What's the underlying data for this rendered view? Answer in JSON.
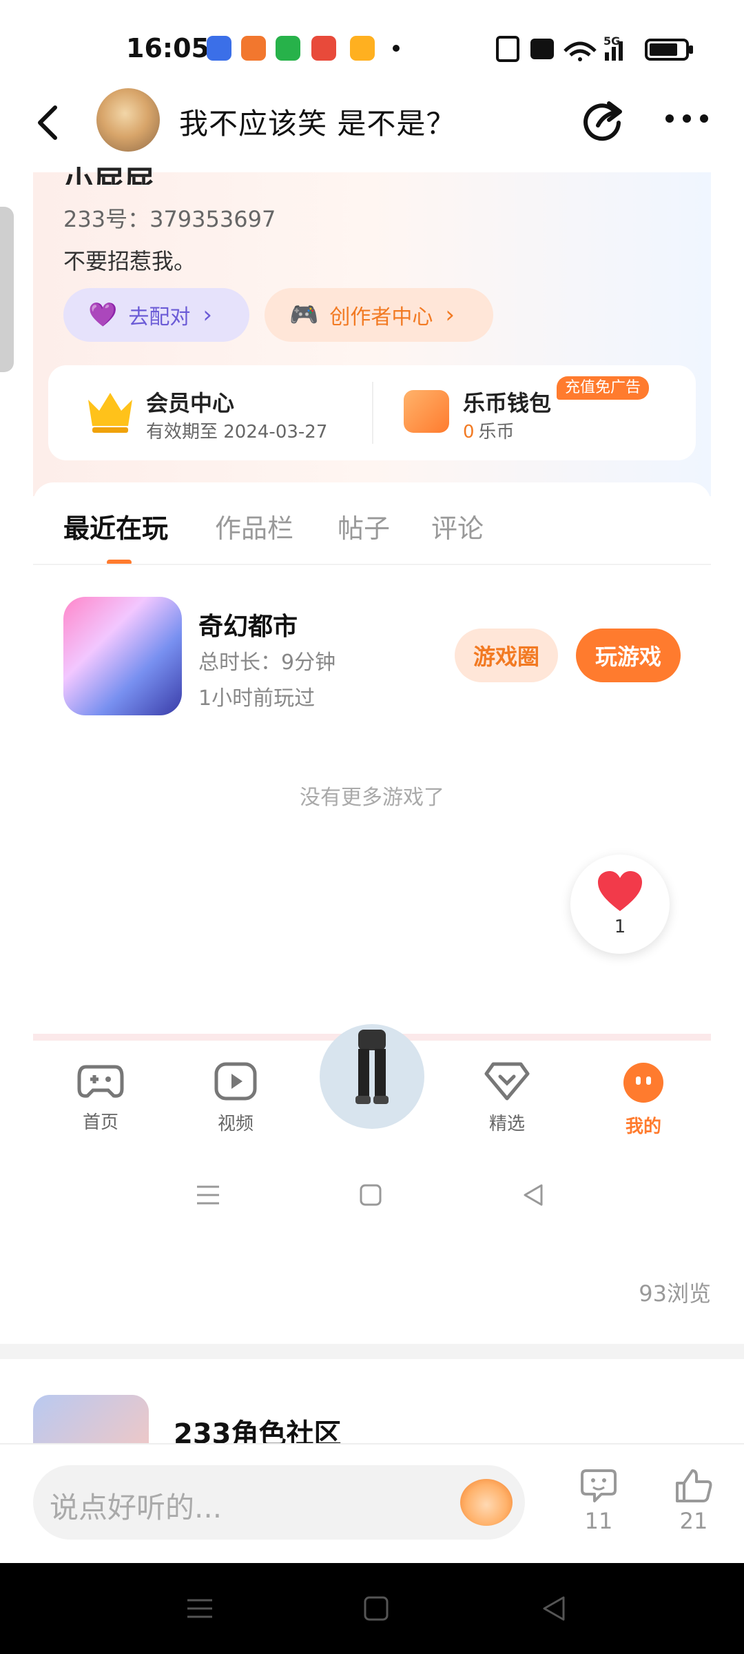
{
  "status_bar": {
    "time": "16:05",
    "network": "5G"
  },
  "header": {
    "title": "我不应该笑   是不是？"
  },
  "profile": {
    "partial_name": "小屁屁",
    "id_line": "233号：379353697",
    "bio": "不要招惹我。",
    "pair_button": "去配对",
    "creator_button": "创作者中心"
  },
  "membership": {
    "title": "会员中心",
    "expiry": "有效期至 2024-03-27"
  },
  "wallet": {
    "title": "乐币钱包",
    "amount": "0",
    "unit": "乐币",
    "badge": "充值免广告"
  },
  "tabs": [
    {
      "label": "最近在玩"
    },
    {
      "label": "作品栏"
    },
    {
      "label": "帖子"
    },
    {
      "label": "评论"
    }
  ],
  "game": {
    "name": "奇幻都市",
    "duration": "总时长：9分钟",
    "last_played": "1小时前玩过",
    "circle_button": "游戏圈",
    "play_button": "玩游戏"
  },
  "no_more_text": "没有更多游戏了",
  "like_float": {
    "count": "1"
  },
  "bottom_nav": [
    {
      "label": "首页",
      "icon": "gamepad-icon"
    },
    {
      "label": "视频",
      "icon": "video-play-icon"
    },
    {
      "label": "精选",
      "icon": "diamond-heart-icon"
    },
    {
      "label": "我的",
      "icon": "profile-face-icon"
    }
  ],
  "views_text": "93浏览",
  "feed_next": {
    "title": "233角色社区"
  },
  "comment_bar": {
    "placeholder": "说点好听的...",
    "comment_count": "11",
    "like_count": "21"
  },
  "colors": {
    "accent_orange": "#ff7b2e",
    "accent_purple": "#6b5bd6",
    "like_red": "#f23a4a"
  }
}
